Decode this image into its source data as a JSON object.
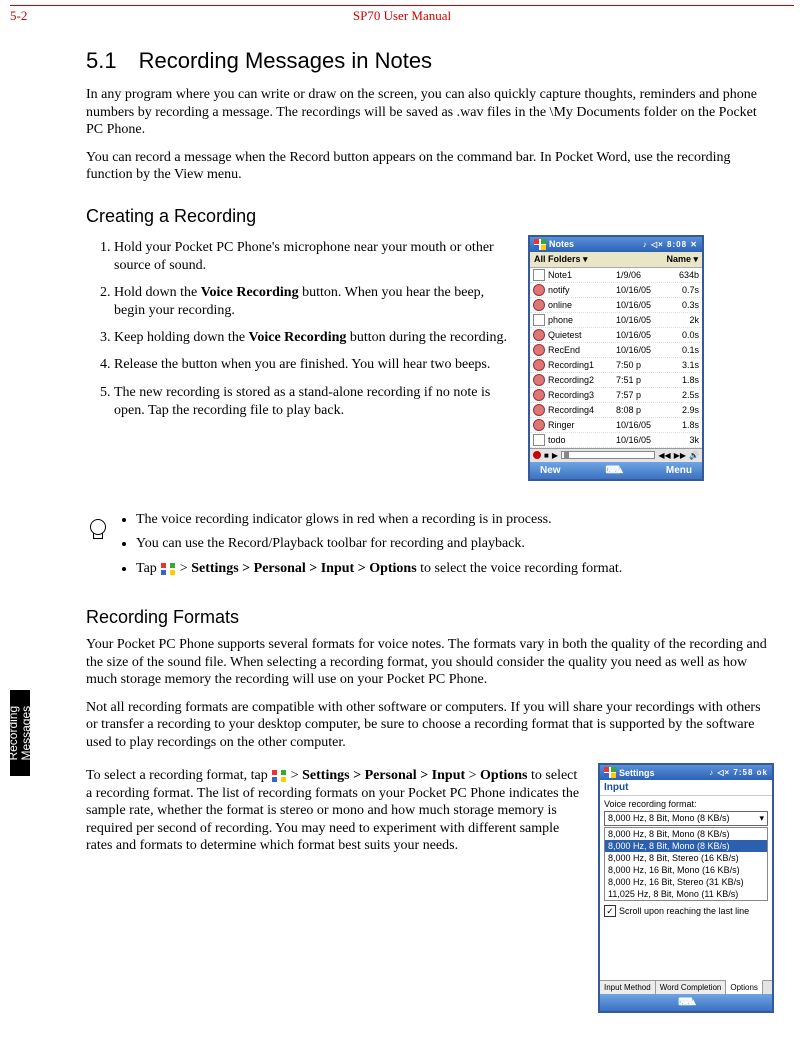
{
  "page_number": "5-2",
  "manual_title": "SP70 User Manual",
  "side_tab": "Recording\nMessages",
  "h1": "5.1 Recording Messages in Notes",
  "intro1": "In any program where you can write or draw on the screen, you can also quickly capture thoughts, reminders and phone numbers by recording a message. The recordings will be saved as .wav files in the \\My Documents folder on the Pocket PC Phone.",
  "intro2": "You can record a message when the Record button appears on the command bar. In Pocket Word, use the recording function by the View menu.",
  "sub1": "Creating a Recording",
  "steps": {
    "s1a": "Hold your Pocket PC Phone's microphone near your mouth or other source of sound.",
    "s2a": "Hold down the ",
    "s2b": "Voice Recording",
    "s2c": " button. When you hear the beep, begin your recording.",
    "s3a": "Keep holding down the ",
    "s3b": "Voice Recording",
    "s3c": " button during the recording.",
    "s4a": "Release the button when you are finished. You will hear two beeps.",
    "s5a": "The new recording is stored as a stand-alone recording if no note is open. Tap the recording file to play back."
  },
  "tips": {
    "t1": "The voice recording indicator glows in red when a recording is in process.",
    "t2": "You can use the Record/Playback toolbar for recording and playback.",
    "t3a": "Tap ",
    "t3b": " > ",
    "t3c": "Settings",
    "t3d": " > ",
    "t3e": "Personal",
    "t3f": " > ",
    "t3g": "Input",
    "t3h": " > ",
    "t3i": "Options",
    "t3j": " to select the voice recording format."
  },
  "sub2": "Recording Formats",
  "rf_p1": "Your Pocket PC Phone supports several formats for voice notes. The formats vary in both the quality of the recording and the size of the sound file. When selecting a recording format, you should consider the quality you need as well as how much storage memory the recording will use on your Pocket PC Phone.",
  "rf_p2": "Not all recording formats are compatible with other software or computers. If you will share your recordings with others or transfer a recording to your desktop computer, be sure to choose a recording format that is supported by the software used to play recordings on the other computer.",
  "rf_p3a": "To select a recording format, tap ",
  "rf_p3b": " > ",
  "rf_p3c": "Settings",
  "rf_p3d": " > ",
  "rf_p3e": "Personal",
  "rf_p3f": " > ",
  "rf_p3g": "Input",
  "rf_p3h": " > ",
  "rf_p3i": "Options",
  "rf_p3j": " to select a recording format. The list of recording formats on your Pocket PC Phone indicates the sample rate, whether the format is stereo or mono and how much storage memory is required per second of recording. You may need to experiment with different sample rates and formats to determine which format best suits your needs.",
  "shot1": {
    "title": "Notes",
    "tb_right": "♪ ◁× 8:08  ✕",
    "hdr_left": "All Folders ▾",
    "hdr_right": "Name ▾",
    "rows": [
      {
        "n": "Note1",
        "d": "1/9/06",
        "s": "634b"
      },
      {
        "n": "notify",
        "d": "10/16/05",
        "s": "0.7s"
      },
      {
        "n": "online",
        "d": "10/16/05",
        "s": "0.3s"
      },
      {
        "n": "phone",
        "d": "10/16/05",
        "s": "2k"
      },
      {
        "n": "Quietest",
        "d": "10/16/05",
        "s": "0.0s"
      },
      {
        "n": "RecEnd",
        "d": "10/16/05",
        "s": "0.1s"
      },
      {
        "n": "Recording1",
        "d": "7:50 p",
        "s": "3.1s"
      },
      {
        "n": "Recording2",
        "d": "7:51 p",
        "s": "1.8s"
      },
      {
        "n": "Recording3",
        "d": "7:57 p",
        "s": "2.5s"
      },
      {
        "n": "Recording4",
        "d": "8:08 p",
        "s": "2.9s"
      },
      {
        "n": "Ringer",
        "d": "10/16/05",
        "s": "1.8s"
      },
      {
        "n": "todo",
        "d": "10/16/05",
        "s": "3k"
      }
    ],
    "soft_left": "New",
    "soft_right": "Menu"
  },
  "shot2": {
    "title": "Settings",
    "tb_right": "♪ ◁× 7:58  ok",
    "subtitle": "Input",
    "label": "Voice recording format:",
    "list": [
      "8,000 Hz, 8 Bit, Mono (8 KB/s)",
      "8,000 Hz, 8 Bit, Mono (8 KB/s)",
      "8,000 Hz, 8 Bit, Stereo (16 KB/s)",
      "8,000 Hz, 16 Bit, Mono (16 KB/s)",
      "8,000 Hz, 16 Bit, Stereo (31 KB/s)",
      "11,025 Hz, 8 Bit, Mono (11 KB/s)"
    ],
    "chk": "Scroll upon reaching the last line",
    "tabs": [
      "Input Method",
      "Word Completion",
      "Options"
    ]
  }
}
